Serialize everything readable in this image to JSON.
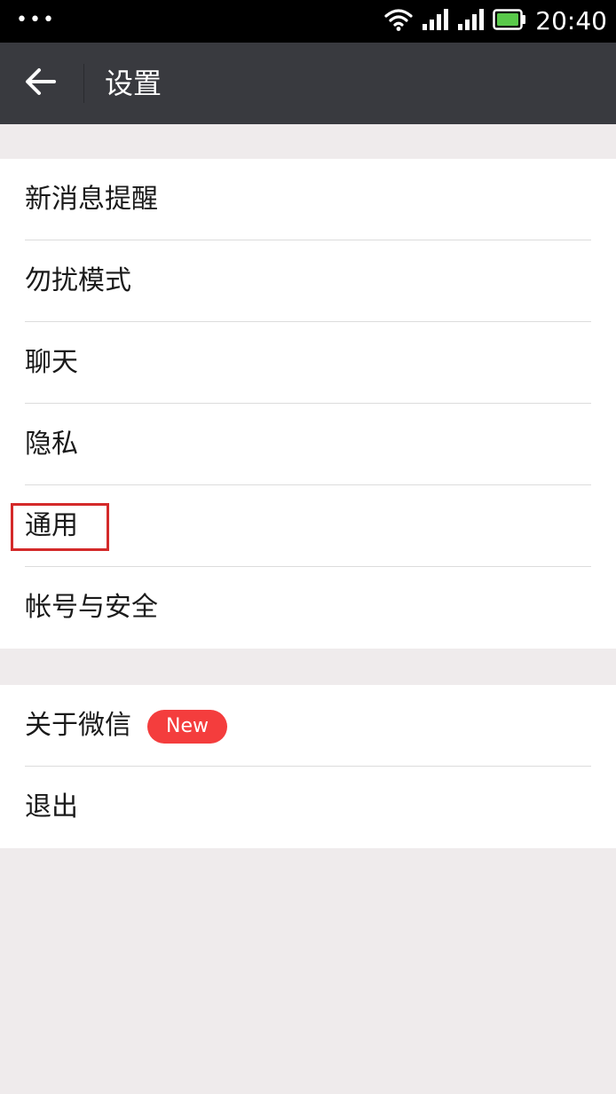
{
  "status_bar": {
    "dots": "•••",
    "time": "20:40",
    "icons": [
      "wifi-icon",
      "cell-signal-icon",
      "cell-signal-icon",
      "battery-icon"
    ]
  },
  "toolbar": {
    "back_icon": "arrow-left-icon",
    "title": "设置"
  },
  "settings_group_1": [
    {
      "label": "新消息提醒"
    },
    {
      "label": "勿扰模式"
    },
    {
      "label": "聊天"
    },
    {
      "label": "隐私"
    },
    {
      "label": "通用"
    },
    {
      "label": "帐号与安全"
    }
  ],
  "settings_group_2": [
    {
      "label": "关于微信",
      "badge": "New"
    },
    {
      "label": "退出"
    }
  ],
  "colors": {
    "toolbar_bg": "#393a3f",
    "page_bg": "#efebec",
    "badge_bg": "#f43d3d",
    "highlight_border": "#d42a2a"
  }
}
